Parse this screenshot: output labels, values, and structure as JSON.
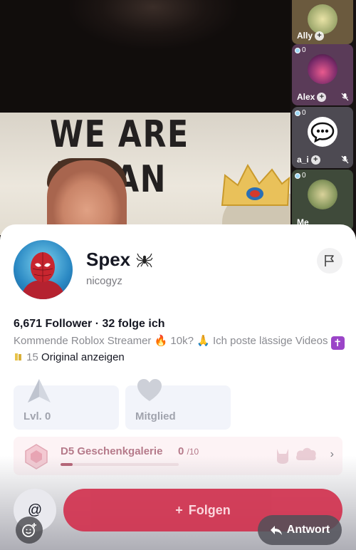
{
  "stream": {
    "banner_line1": "WE ARE ALL",
    "banner_line2": "MAN"
  },
  "guests": [
    {
      "name": "Ally",
      "count": "",
      "muted": false
    },
    {
      "name": "Alex",
      "count": "0",
      "muted": true
    },
    {
      "name": "a_i",
      "count": "0",
      "muted": true
    },
    {
      "name": "Me",
      "count": "0",
      "muted": false
    }
  ],
  "profile": {
    "name": "Spex",
    "name_emoji": "🕷",
    "handle": "nicogyz",
    "stats": "6,671 Follower · 32 folge ich",
    "bio_part1": "Kommende Roblox Streamer 🔥 10k? 🙏 Ich poste lässige Videos ",
    "bio_cross": "✝",
    "bio_count": " 15 ",
    "bio_link": "Original anzeigen"
  },
  "cards": {
    "level_label": "Lvl. 0",
    "member_label": "Mitglied"
  },
  "gallery": {
    "title": "D5 Geschenkgalerie",
    "count": "0",
    "total": "/10",
    "progress": 0.1
  },
  "actions": {
    "at_label": "@",
    "follow_label": "Folgen",
    "follow_plus": "+",
    "reply_label": "Antwort"
  },
  "colors": {
    "follow": "#d1324f",
    "gallery_text": "#b57a8a",
    "muted_text": "#8a8b91"
  }
}
